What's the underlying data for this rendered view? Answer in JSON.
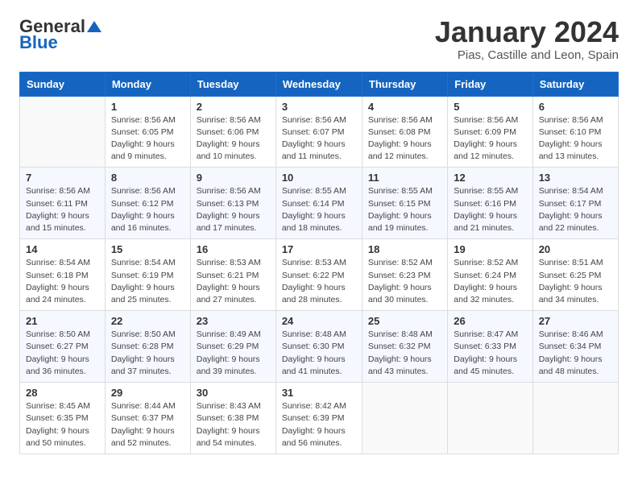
{
  "header": {
    "logo_general": "General",
    "logo_blue": "Blue",
    "month_title": "January 2024",
    "subtitle": "Pias, Castille and Leon, Spain"
  },
  "columns": [
    "Sunday",
    "Monday",
    "Tuesday",
    "Wednesday",
    "Thursday",
    "Friday",
    "Saturday"
  ],
  "weeks": [
    [
      {
        "num": "",
        "info": ""
      },
      {
        "num": "1",
        "info": "Sunrise: 8:56 AM\nSunset: 6:05 PM\nDaylight: 9 hours\nand 9 minutes."
      },
      {
        "num": "2",
        "info": "Sunrise: 8:56 AM\nSunset: 6:06 PM\nDaylight: 9 hours\nand 10 minutes."
      },
      {
        "num": "3",
        "info": "Sunrise: 8:56 AM\nSunset: 6:07 PM\nDaylight: 9 hours\nand 11 minutes."
      },
      {
        "num": "4",
        "info": "Sunrise: 8:56 AM\nSunset: 6:08 PM\nDaylight: 9 hours\nand 12 minutes."
      },
      {
        "num": "5",
        "info": "Sunrise: 8:56 AM\nSunset: 6:09 PM\nDaylight: 9 hours\nand 12 minutes."
      },
      {
        "num": "6",
        "info": "Sunrise: 8:56 AM\nSunset: 6:10 PM\nDaylight: 9 hours\nand 13 minutes."
      }
    ],
    [
      {
        "num": "7",
        "info": "Sunrise: 8:56 AM\nSunset: 6:11 PM\nDaylight: 9 hours\nand 15 minutes."
      },
      {
        "num": "8",
        "info": "Sunrise: 8:56 AM\nSunset: 6:12 PM\nDaylight: 9 hours\nand 16 minutes."
      },
      {
        "num": "9",
        "info": "Sunrise: 8:56 AM\nSunset: 6:13 PM\nDaylight: 9 hours\nand 17 minutes."
      },
      {
        "num": "10",
        "info": "Sunrise: 8:55 AM\nSunset: 6:14 PM\nDaylight: 9 hours\nand 18 minutes."
      },
      {
        "num": "11",
        "info": "Sunrise: 8:55 AM\nSunset: 6:15 PM\nDaylight: 9 hours\nand 19 minutes."
      },
      {
        "num": "12",
        "info": "Sunrise: 8:55 AM\nSunset: 6:16 PM\nDaylight: 9 hours\nand 21 minutes."
      },
      {
        "num": "13",
        "info": "Sunrise: 8:54 AM\nSunset: 6:17 PM\nDaylight: 9 hours\nand 22 minutes."
      }
    ],
    [
      {
        "num": "14",
        "info": "Sunrise: 8:54 AM\nSunset: 6:18 PM\nDaylight: 9 hours\nand 24 minutes."
      },
      {
        "num": "15",
        "info": "Sunrise: 8:54 AM\nSunset: 6:19 PM\nDaylight: 9 hours\nand 25 minutes."
      },
      {
        "num": "16",
        "info": "Sunrise: 8:53 AM\nSunset: 6:21 PM\nDaylight: 9 hours\nand 27 minutes."
      },
      {
        "num": "17",
        "info": "Sunrise: 8:53 AM\nSunset: 6:22 PM\nDaylight: 9 hours\nand 28 minutes."
      },
      {
        "num": "18",
        "info": "Sunrise: 8:52 AM\nSunset: 6:23 PM\nDaylight: 9 hours\nand 30 minutes."
      },
      {
        "num": "19",
        "info": "Sunrise: 8:52 AM\nSunset: 6:24 PM\nDaylight: 9 hours\nand 32 minutes."
      },
      {
        "num": "20",
        "info": "Sunrise: 8:51 AM\nSunset: 6:25 PM\nDaylight: 9 hours\nand 34 minutes."
      }
    ],
    [
      {
        "num": "21",
        "info": "Sunrise: 8:50 AM\nSunset: 6:27 PM\nDaylight: 9 hours\nand 36 minutes."
      },
      {
        "num": "22",
        "info": "Sunrise: 8:50 AM\nSunset: 6:28 PM\nDaylight: 9 hours\nand 37 minutes."
      },
      {
        "num": "23",
        "info": "Sunrise: 8:49 AM\nSunset: 6:29 PM\nDaylight: 9 hours\nand 39 minutes."
      },
      {
        "num": "24",
        "info": "Sunrise: 8:48 AM\nSunset: 6:30 PM\nDaylight: 9 hours\nand 41 minutes."
      },
      {
        "num": "25",
        "info": "Sunrise: 8:48 AM\nSunset: 6:32 PM\nDaylight: 9 hours\nand 43 minutes."
      },
      {
        "num": "26",
        "info": "Sunrise: 8:47 AM\nSunset: 6:33 PM\nDaylight: 9 hours\nand 45 minutes."
      },
      {
        "num": "27",
        "info": "Sunrise: 8:46 AM\nSunset: 6:34 PM\nDaylight: 9 hours\nand 48 minutes."
      }
    ],
    [
      {
        "num": "28",
        "info": "Sunrise: 8:45 AM\nSunset: 6:35 PM\nDaylight: 9 hours\nand 50 minutes."
      },
      {
        "num": "29",
        "info": "Sunrise: 8:44 AM\nSunset: 6:37 PM\nDaylight: 9 hours\nand 52 minutes."
      },
      {
        "num": "30",
        "info": "Sunrise: 8:43 AM\nSunset: 6:38 PM\nDaylight: 9 hours\nand 54 minutes."
      },
      {
        "num": "31",
        "info": "Sunrise: 8:42 AM\nSunset: 6:39 PM\nDaylight: 9 hours\nand 56 minutes."
      },
      {
        "num": "",
        "info": ""
      },
      {
        "num": "",
        "info": ""
      },
      {
        "num": "",
        "info": ""
      }
    ]
  ]
}
